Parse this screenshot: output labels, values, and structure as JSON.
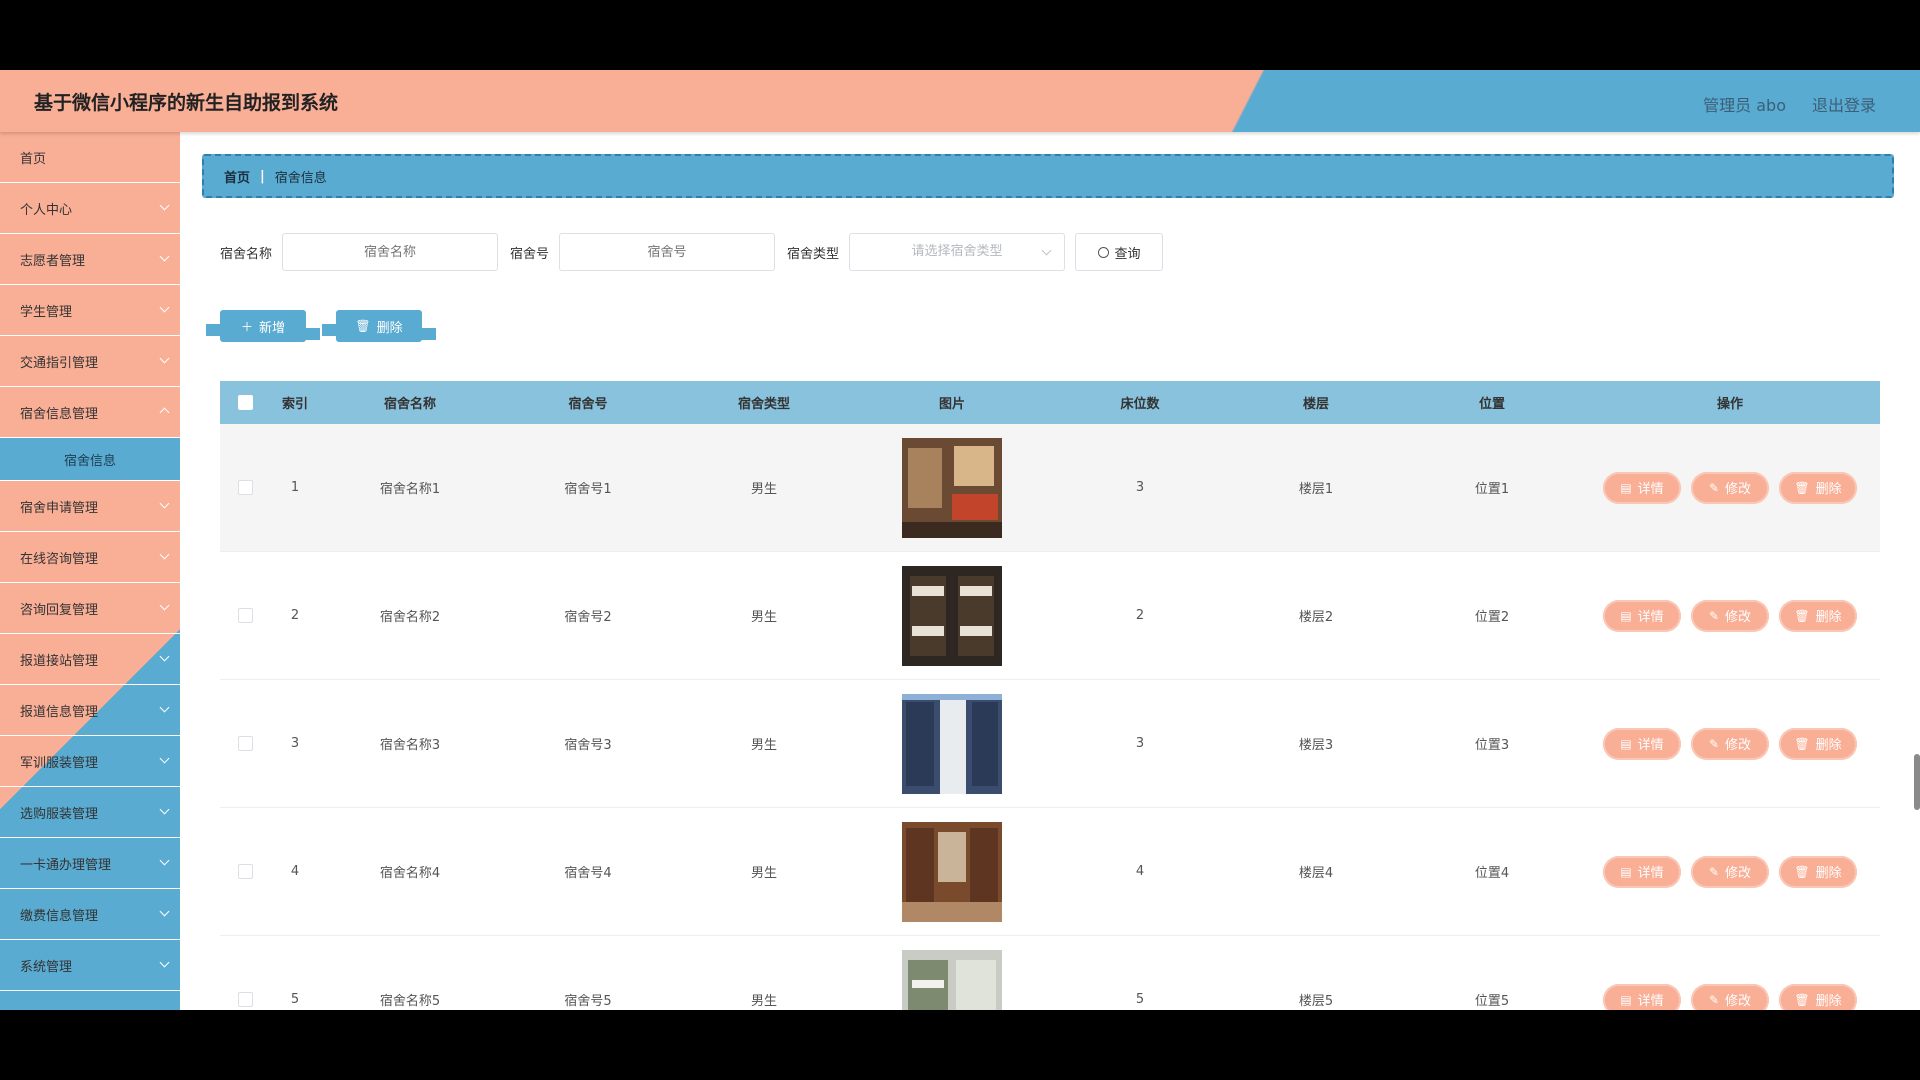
{
  "header": {
    "title": "基于微信小程序的新生自助报到系统",
    "admin_label": "管理员 abo",
    "logout_label": "退出登录"
  },
  "sidebar": {
    "items": [
      {
        "label": "首页"
      },
      {
        "label": "个人中心"
      },
      {
        "label": "志愿者管理"
      },
      {
        "label": "学生管理"
      },
      {
        "label": "交通指引管理"
      },
      {
        "label": "宿舍信息管理"
      }
    ],
    "active_sub": "宿舍信息",
    "items2": [
      {
        "label": "宿舍申请管理"
      },
      {
        "label": "在线咨询管理"
      },
      {
        "label": "咨询回复管理"
      },
      {
        "label": "报道接站管理"
      },
      {
        "label": "报道信息管理"
      },
      {
        "label": "军训服装管理"
      },
      {
        "label": "选购服装管理"
      },
      {
        "label": "一卡通办理管理"
      },
      {
        "label": "缴费信息管理"
      },
      {
        "label": "系统管理"
      }
    ]
  },
  "breadcrumb": {
    "home": "首页",
    "current": "宿舍信息"
  },
  "search": {
    "name_label": "宿舍名称",
    "name_placeholder": "宿舍名称",
    "number_label": "宿舍号",
    "number_placeholder": "宿舍号",
    "type_label": "宿舍类型",
    "type_placeholder": "请选择宿舍类型",
    "query_label": "查询"
  },
  "actions": {
    "add_label": "新增",
    "delete_label": "删除"
  },
  "table": {
    "headers": [
      "索引",
      "宿舍名称",
      "宿舍号",
      "宿舍类型",
      "图片",
      "床位数",
      "楼层",
      "位置",
      "操作"
    ],
    "detail_label": "详情",
    "edit_label": "修改",
    "delete_label": "删除",
    "rows": [
      {
        "index": "1",
        "name": "宿舍名称1",
        "number": "宿舍号1",
        "type": "男生",
        "beds": "3",
        "floor": "楼层1",
        "location": "位置1"
      },
      {
        "index": "2",
        "name": "宿舍名称2",
        "number": "宿舍号2",
        "type": "男生",
        "beds": "2",
        "floor": "楼层2",
        "location": "位置2"
      },
      {
        "index": "3",
        "name": "宿舍名称3",
        "number": "宿舍号3",
        "type": "男生",
        "beds": "3",
        "floor": "楼层3",
        "location": "位置3"
      },
      {
        "index": "4",
        "name": "宿舍名称4",
        "number": "宿舍号4",
        "type": "男生",
        "beds": "4",
        "floor": "楼层4",
        "location": "位置4"
      },
      {
        "index": "5",
        "name": "宿舍名称5",
        "number": "宿舍号5",
        "type": "男生",
        "beds": "5",
        "floor": "楼层5",
        "location": "位置5"
      }
    ]
  },
  "colors": {
    "salmon": "#f9ae96",
    "blue": "#5aabd1",
    "header_blue": "#89c2dd"
  }
}
